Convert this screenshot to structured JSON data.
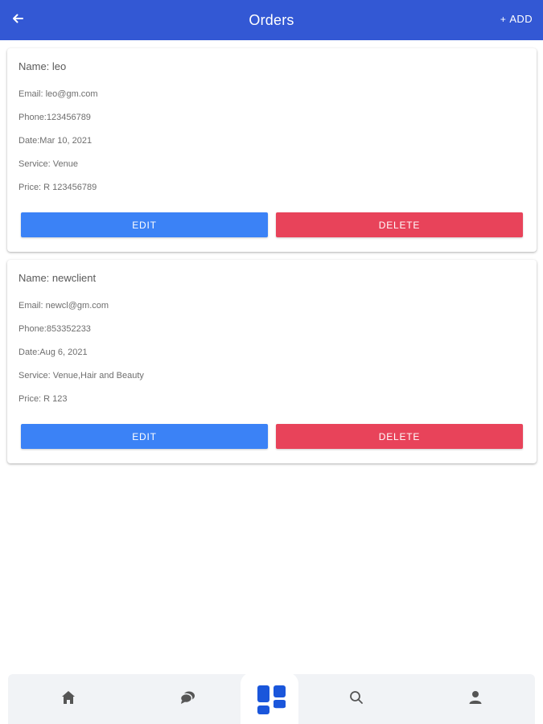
{
  "header": {
    "title": "Orders",
    "back_icon": "arrow-left-icon",
    "add_label": "ADD",
    "add_icon": "plus-icon",
    "background": "#3358d4"
  },
  "orders": [
    {
      "name": "Name: leo",
      "email": "Email: leo@gm.com",
      "phone": "Phone:123456789",
      "date": "Date:Mar 10, 2021",
      "service": "Service: Venue",
      "price": "Price: R 123456789",
      "edit_label": "EDIT",
      "delete_label": "DELETE"
    },
    {
      "name": "Name: newclient",
      "email": "Email: newcl@gm.com",
      "phone": "Phone:853352233",
      "date": "Date:Aug 6, 2021",
      "service": "Service: Venue,Hair and Beauty",
      "price": "Price: R 123",
      "edit_label": "EDIT",
      "delete_label": "DELETE"
    }
  ],
  "colors": {
    "edit": "#3b82f6",
    "delete": "#e8435a",
    "nav_active": "#1a56db",
    "nav_inactive": "#555555"
  },
  "bottom_nav": {
    "items": [
      "home-icon",
      "chat-icon",
      "dashboard-icon",
      "search-icon",
      "profile-icon"
    ],
    "active": "dashboard-icon"
  }
}
